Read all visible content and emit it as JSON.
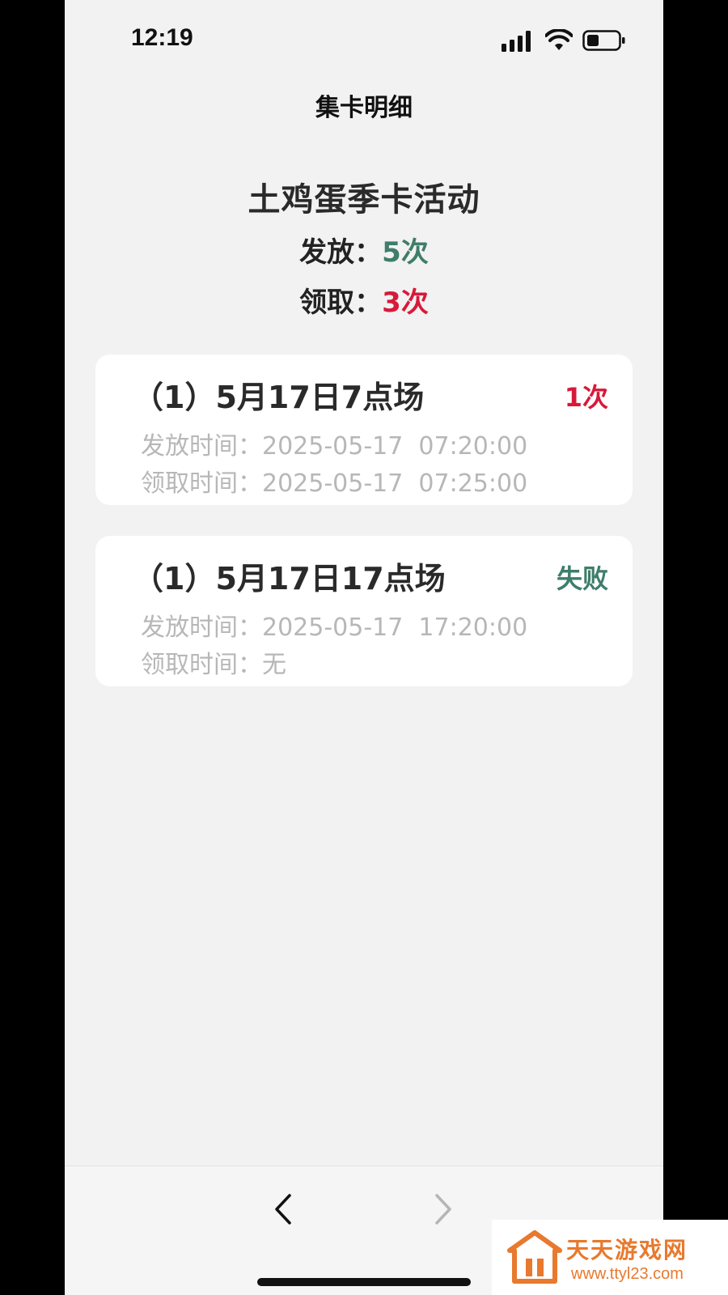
{
  "status_bar": {
    "time": "12:19"
  },
  "nav": {
    "title": "集卡明细"
  },
  "activity": {
    "title": "土鸡蛋季卡活动",
    "issued_label": "发放：",
    "issued_value": "5次",
    "received_label": "领取：",
    "received_value": "3次"
  },
  "records": [
    {
      "title": "（1）5月17日7点场",
      "status": "1次",
      "issue_label": "发放时间：",
      "issue_time": "2025-05-17  07:20:00",
      "receive_label": "领取时间：",
      "receive_time": "2025-05-17  07:25:00"
    },
    {
      "title": "（1）5月17日17点场",
      "status": "失败",
      "issue_label": "发放时间：",
      "issue_time": "2025-05-17  17:20:00",
      "receive_label": "领取时间：",
      "receive_time": "无"
    }
  ],
  "colors": {
    "green": "#3f7d6a",
    "red": "#d8193a",
    "background": "#f2f2f2"
  },
  "icons": [
    "signal-icon",
    "wifi-icon",
    "battery-icon",
    "chevron-left-icon",
    "chevron-right-icon"
  ],
  "watermark": {
    "name": "天天游戏网",
    "url": "www.ttyl23.com"
  }
}
